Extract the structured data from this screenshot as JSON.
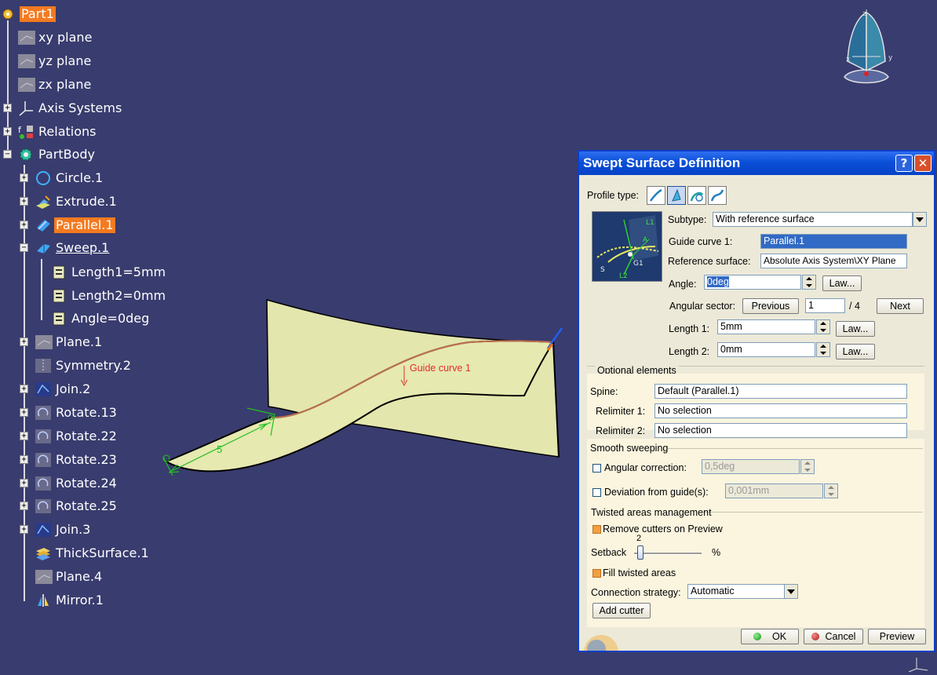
{
  "tree": {
    "items": [
      {
        "label": "Part1"
      },
      {
        "label": "xy plane"
      },
      {
        "label": "yz plane"
      },
      {
        "label": "zx plane"
      },
      {
        "label": "Axis Systems"
      },
      {
        "label": "Relations"
      },
      {
        "label": "PartBody"
      },
      {
        "label": "Circle.1"
      },
      {
        "label": "Extrude.1"
      },
      {
        "label": "Parallel.1"
      },
      {
        "label": "Sweep.1"
      },
      {
        "label": "Length1=5mm"
      },
      {
        "label": "Length2=0mm"
      },
      {
        "label": "Angle=0deg"
      },
      {
        "label": "Plane.1"
      },
      {
        "label": "Symmetry.2"
      },
      {
        "label": "Join.2"
      },
      {
        "label": "Rotate.13"
      },
      {
        "label": "Rotate.22"
      },
      {
        "label": "Rotate.23"
      },
      {
        "label": "Rotate.24"
      },
      {
        "label": "Rotate.25"
      },
      {
        "label": "Join.3"
      },
      {
        "label": "ThickSurface.1"
      },
      {
        "label": "Plane.4"
      },
      {
        "label": "Mirror.1"
      }
    ]
  },
  "viewport": {
    "guide_curve_label": "Guide curve 1",
    "dimension_label": "5"
  },
  "compass": {
    "x": "x",
    "y": "y",
    "z": "z"
  },
  "dialog": {
    "title": "Swept Surface Definition",
    "help_glyph": "?",
    "close_glyph": "✕",
    "profile_type_label": "Profile type:",
    "subtype_label": "Subtype:",
    "subtype_value": "With reference surface",
    "guide_curve_label": "Guide curve 1:",
    "guide_curve_value": "Parallel.1",
    "reference_surface_label": "Reference surface:",
    "reference_surface_value": "Absolute Axis System\\XY Plane",
    "angle_label": "Angle:",
    "angle_value": "0deg",
    "law_button": "Law...",
    "angular_sector_label": "Angular sector:",
    "previous_button": "Previous",
    "sector_value": "1",
    "sector_total": "/ 4",
    "next_button": "Next",
    "length1_label": "Length 1:",
    "length1_value": "5mm",
    "length2_label": "Length 2:",
    "length2_value": "0mm",
    "optional_elements_label": "Optional elements",
    "spine_label": "Spine:",
    "spine_value": "Default (Parallel.1)",
    "relimiter1_label": "Relimiter 1:",
    "relimiter1_value": "No selection",
    "relimiter2_label": "Relimiter 2:",
    "relimiter2_value": "No selection",
    "smooth_sweeping_label": "Smooth sweeping",
    "angular_correction_label": "Angular correction:",
    "angular_correction_value": "0,5deg",
    "deviation_label": "Deviation from guide(s):",
    "deviation_value": "0,001mm",
    "twisted_areas_label": "Twisted areas management",
    "remove_cutters_label": "Remove cutters on Preview",
    "setback_label": "Setback",
    "setback_value": "2",
    "setback_unit": "%",
    "fill_twisted_label": "Fill twisted areas",
    "connection_strategy_label": "Connection strategy:",
    "connection_strategy_value": "Automatic",
    "add_cutter_button": "Add cutter",
    "ok_button": "OK",
    "cancel_button": "Cancel",
    "preview_button": "Preview",
    "diagram_labels": {
      "l1": "L1",
      "a": "A",
      "g1": "G1",
      "s": "S",
      "l2": "L2"
    }
  }
}
